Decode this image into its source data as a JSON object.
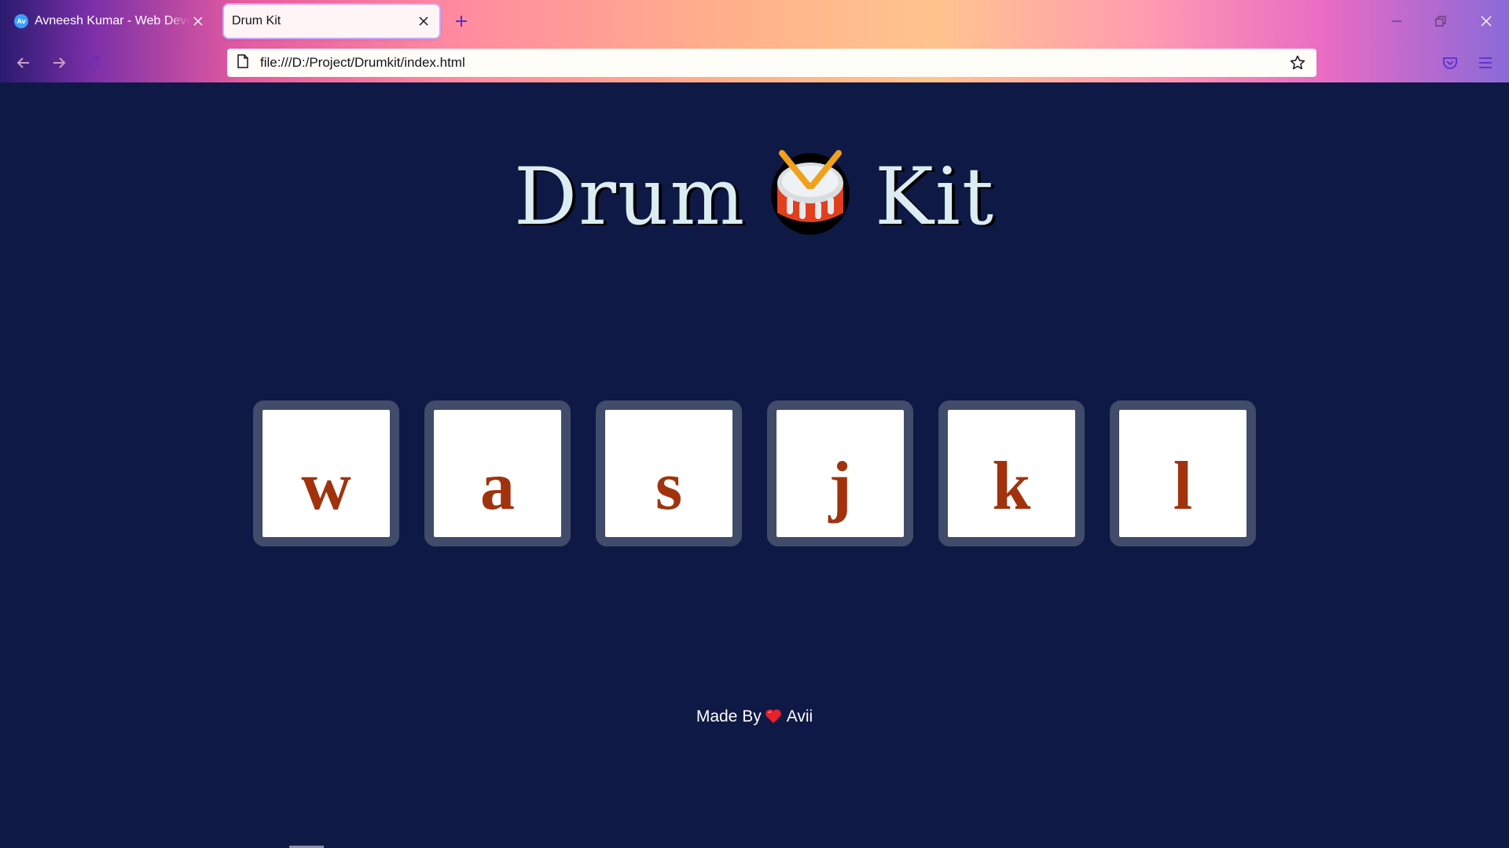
{
  "browser": {
    "tabs": [
      {
        "favicon": "Av",
        "title": "Avneesh Kumar - Web Developer",
        "active": false
      },
      {
        "title": "Drum Kit",
        "active": true
      }
    ],
    "url": "file:///D:/Project/Drumkit/index.html",
    "icons": [
      "back-arrow-icon",
      "forward-arrow-icon",
      "reload-icon",
      "page-icon",
      "bookmark-star-icon",
      "pocket-icon",
      "hamburger-menu-icon",
      "new-tab-plus-icon",
      "minimize-icon",
      "restore-icon",
      "close-icon"
    ]
  },
  "page": {
    "title_left": "Drum",
    "title_emoji": "drum-icon",
    "title_right": "Kit",
    "drums": [
      {
        "key": "w"
      },
      {
        "key": "a"
      },
      {
        "key": "s"
      },
      {
        "key": "j"
      },
      {
        "key": "k"
      },
      {
        "key": "l"
      }
    ],
    "footer": {
      "prefix": "Made By",
      "icon": "heart-icon",
      "author": "Avii"
    }
  },
  "colors": {
    "background": "#0f1945",
    "title_text": "#dbedf3",
    "drum_border": "#414b6a",
    "drum_letter": "#a0330e",
    "heart": "#e8202a"
  }
}
